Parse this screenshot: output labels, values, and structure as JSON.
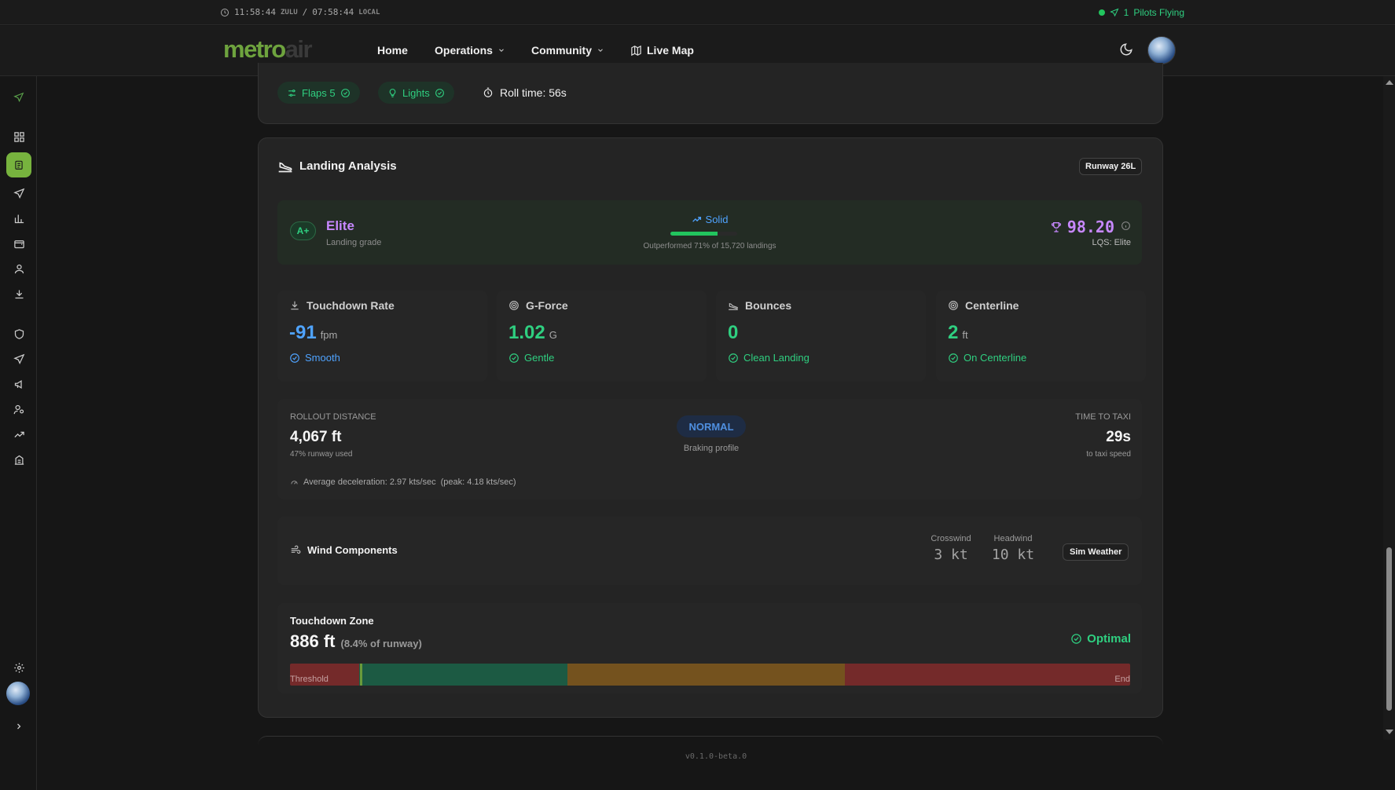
{
  "statusbar": {
    "zulu_time": "11:58:44",
    "zulu_label": "ZULU",
    "separator": "/",
    "local_time": "07:58:44",
    "local_label": "LOCAL",
    "pilots_count": "1",
    "pilots_label": "Pilots Flying"
  },
  "nav": {
    "logo_main": "metro",
    "logo_accent": "air",
    "home": "Home",
    "operations": "Operations",
    "community": "Community",
    "live_map": "Live Map"
  },
  "takeoff": {
    "flaps_label": "Flaps 5",
    "lights_label": "Lights",
    "roll_time": "Roll time: 56s"
  },
  "landing": {
    "title": "Landing Analysis",
    "runway": "Runway 26L",
    "grade_letter": "A+",
    "grade_name": "Elite",
    "grade_sub": "Landing grade",
    "quality": "Solid",
    "quality_progress": 0.71,
    "outperformed": "Outperformed 71% of 15,720 landings",
    "lqs_score": "98.20",
    "lqs_label": "LQS: Elite"
  },
  "metrics": [
    {
      "label": "Touchdown Rate",
      "value": "-91",
      "unit": "fpm",
      "status": "Smooth",
      "color": "#4fa3ff"
    },
    {
      "label": "G-Force",
      "value": "1.02",
      "unit": "G",
      "status": "Gentle",
      "color": "#2fcf80"
    },
    {
      "label": "Bounces",
      "value": "0",
      "unit": "",
      "status": "Clean Landing",
      "color": "#2fcf80"
    },
    {
      "label": "Centerline",
      "value": "2",
      "unit": "ft",
      "status": "On Centerline",
      "color": "#2fcf80"
    }
  ],
  "rollout": {
    "label": "ROLLOUT DISTANCE",
    "value": "4,067 ft",
    "sub": "47% runway used",
    "braking": "NORMAL",
    "braking_label": "Braking profile",
    "taxi_label": "TIME TO TAXI",
    "taxi_value": "29s",
    "taxi_sub": "to taxi speed",
    "decel": "Average deceleration: 2.97 kts/sec",
    "decel_peak": "(peak: 4.18 kts/sec)"
  },
  "wind": {
    "title": "Wind Components",
    "crosswind_label": "Crosswind",
    "crosswind_value": "3 kt",
    "headwind_label": "Headwind",
    "headwind_value": "10 kt",
    "source": "Sim Weather"
  },
  "touchdown": {
    "title": "Touchdown Zone",
    "distance": "886 ft",
    "percent": "(8.4% of runway)",
    "status": "Optimal",
    "start_label": "Threshold",
    "end_label": "End",
    "marker_fraction": 0.084,
    "zones": [
      {
        "fraction": 0.082,
        "color": "#742a2a"
      },
      {
        "fraction": 0.248,
        "color": "#1c5a43"
      },
      {
        "fraction": 0.33,
        "color": "#74521e"
      },
      {
        "fraction": 0.34,
        "color": "#742a2a"
      }
    ]
  },
  "version": "v0.1.0-beta.0",
  "colors": {
    "accent_green": "#2fcf80",
    "brand_green": "#77b33e",
    "purple": "#c788ff",
    "blue": "#4fa3ff"
  }
}
